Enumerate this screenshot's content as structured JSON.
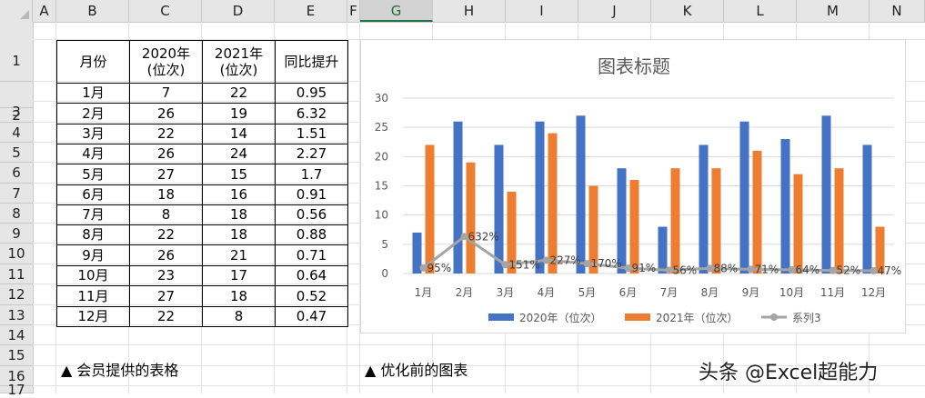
{
  "columns": [
    "A",
    "B",
    "C",
    "D",
    "E",
    "F",
    "G",
    "H",
    "I",
    "J",
    "K",
    "L",
    "M",
    "N"
  ],
  "selected_column": "G",
  "rows": [
    "1",
    "2",
    "3",
    "4",
    "5",
    "6",
    "7",
    "8",
    "9",
    "10",
    "11",
    "12",
    "13",
    "14",
    "15",
    "16",
    "17"
  ],
  "table": {
    "headers": [
      "月份",
      "2020年\n(位次)",
      "2021年\n(位次)",
      "同比提升"
    ],
    "rows": [
      [
        "1月",
        "7",
        "22",
        "0.95"
      ],
      [
        "2月",
        "26",
        "19",
        "6.32"
      ],
      [
        "3月",
        "22",
        "14",
        "1.51"
      ],
      [
        "4月",
        "26",
        "24",
        "2.27"
      ],
      [
        "5月",
        "27",
        "15",
        "1.7"
      ],
      [
        "6月",
        "18",
        "16",
        "0.91"
      ],
      [
        "7月",
        "8",
        "18",
        "0.56"
      ],
      [
        "8月",
        "22",
        "18",
        "0.88"
      ],
      [
        "9月",
        "26",
        "21",
        "0.71"
      ],
      [
        "10月",
        "23",
        "17",
        "0.64"
      ],
      [
        "11月",
        "27",
        "18",
        "0.52"
      ],
      [
        "12月",
        "22",
        "8",
        "0.47"
      ]
    ]
  },
  "chart_data": {
    "type": "bar",
    "title": "图表标题",
    "categories": [
      "1月",
      "2月",
      "3月",
      "4月",
      "5月",
      "6月",
      "7月",
      "8月",
      "9月",
      "10月",
      "11月",
      "12月"
    ],
    "series": [
      {
        "name": "2020年（位次）",
        "kind": "bar",
        "color": "#4472c4",
        "values": [
          7,
          26,
          22,
          26,
          27,
          18,
          8,
          22,
          26,
          23,
          27,
          22
        ]
      },
      {
        "name": "2021年（位次）",
        "kind": "bar",
        "color": "#ed7d31",
        "values": [
          22,
          19,
          14,
          24,
          15,
          16,
          18,
          18,
          21,
          17,
          18,
          8
        ]
      },
      {
        "name": "系列3",
        "kind": "line",
        "color": "#a5a5a5",
        "values": [
          0.95,
          6.32,
          1.51,
          2.27,
          1.7,
          0.91,
          0.56,
          0.88,
          0.71,
          0.64,
          0.52,
          0.47
        ],
        "labels": [
          "95%",
          "632%",
          "151%",
          "227%",
          "170%",
          "91%",
          "56%",
          "88%",
          "71%",
          "64%",
          "52%",
          "47%"
        ]
      }
    ],
    "yticks": [
      "0",
      "5",
      "10",
      "15",
      "20",
      "25",
      "30"
    ],
    "ylim": [
      0,
      30
    ],
    "grid": true,
    "legend": "bottom"
  },
  "notes": {
    "left": "▲ 会员提供的表格",
    "right": "▲ 优化前的图表"
  },
  "watermark": "头条 @Excel超能力"
}
